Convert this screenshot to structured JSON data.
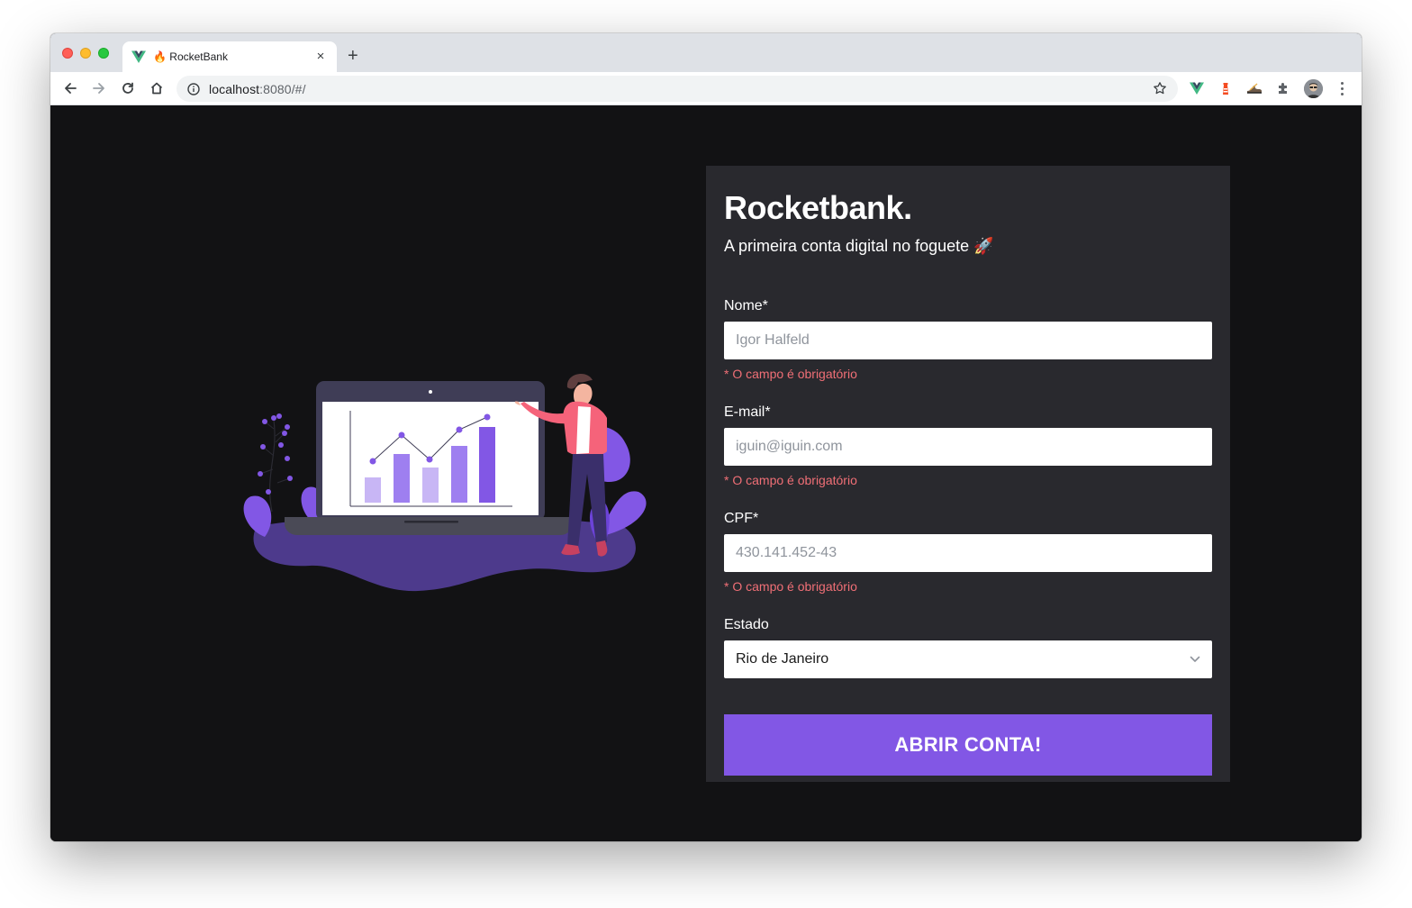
{
  "browser": {
    "tab_title": "🔥 RocketBank",
    "url_host": "localhost",
    "url_rest": ":8080/#/",
    "new_tab_label": "+",
    "close_label": "×"
  },
  "form": {
    "brand": "Rocketbank.",
    "tagline": "A primeira conta digital no foguete 🚀",
    "fields": [
      {
        "label": "Nome*",
        "placeholder": "Igor Halfeld",
        "error": "* O campo é obrigatório"
      },
      {
        "label": "E-mail*",
        "placeholder": "iguin@iguin.com",
        "error": "* O campo é obrigatório"
      },
      {
        "label": "CPF*",
        "placeholder": "430.141.452-43",
        "error": "* O campo é obrigatório"
      }
    ],
    "state": {
      "label": "Estado",
      "value": "Rio de Janeiro"
    },
    "submit_label": "ABRIR CONTA!"
  },
  "colors": {
    "accent": "#8257e5",
    "error": "#f06f76",
    "background": "#121214",
    "card": "#29292e"
  },
  "icons": {
    "nav": [
      "back-arrow-icon",
      "forward-arrow-icon",
      "reload-icon",
      "home-icon",
      "info-icon",
      "star-icon"
    ],
    "extensions": [
      "vue-devtools-icon",
      "lighthouse-icon",
      "extension-shoe-icon",
      "puzzle-icon"
    ]
  }
}
